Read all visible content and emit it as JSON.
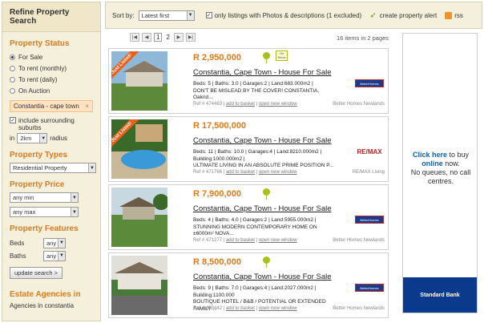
{
  "sidebar": {
    "heading": "Refine Property Search",
    "status_title": "Property Status",
    "status_options": [
      {
        "label": "For Sale",
        "selected": true
      },
      {
        "label": "To rent (monthly)",
        "selected": false
      },
      {
        "label": "To rent (daily)",
        "selected": false
      },
      {
        "label": "On Auction",
        "selected": false
      }
    ],
    "location_tag": "Constantia - cape town",
    "location_tag_remove": "×",
    "include_suburbs_label": "include surrounding suburbs",
    "radius_prefix": "in",
    "radius_value": "2km",
    "radius_suffix": "radius",
    "types_title": "Property Types",
    "type_value": "Residential Property",
    "price_title": "Property Price",
    "price_min": "any min",
    "price_max": "any max",
    "features_title": "Property Features",
    "beds_label": "Beds",
    "beds_value": "any",
    "baths_label": "Baths",
    "baths_value": "any",
    "update_button": "update search >",
    "agencies_title": "Estate Agencies in",
    "agencies_sub": "Agencies in constantia"
  },
  "topbar": {
    "sort_label": "Sort by:",
    "sort_value": "Latest first",
    "only_listings_label": "only listings with Photos & descriptions (1 excluded)",
    "alert_label": "create property alert",
    "rss_label": "rss"
  },
  "pager": {
    "pages": [
      "1",
      "2"
    ],
    "current": "1",
    "info": "16 items in 2 pages"
  },
  "listings": [
    {
      "price": "R 2,950,000",
      "title": "Constantia, Cape Town - House For Sale",
      "details": "Beds: 5 | Baths: 3.0 | Garages:2 | Land:683.000m2 |",
      "blurb": "DON'T BE MISLEAD BY THE COVER! CONSTANTIA, Oakrid...",
      "ref": "Ref # 474463",
      "basket": "add to basket",
      "newwin": "open new window",
      "agent": "Better Homes Newlands",
      "logo": "BetterHomes",
      "just_listed": "Just Listed!",
      "on_show": "On Show",
      "photo_sky": "#8fb8d8",
      "photo_ground": "#5d8a3a",
      "photo_house": "#d8d0c0"
    },
    {
      "price": "R 17,500,000",
      "title": "Constantia, Cape Town - House For Sale",
      "details": "Beds: 11 | Baths: 10.0 | Garages:4 | Land:8210.000m2 |",
      "details2": "Building:1000.000m2 |",
      "blurb": "ULTIMATE LIVING IN AN ABSOLUTE PRIME POSITION P...",
      "ref": "Ref # 471766",
      "basket": "add to basket",
      "newwin": "open new window",
      "agent": "RE/MAX Living",
      "logo": "RE/MAX",
      "just_listed": "Just Listed!",
      "photo_sky": "#3a6a2a",
      "photo_ground": "#3a9ad8",
      "photo_house": "#c8a878"
    },
    {
      "price": "R 7,900,000",
      "title": "Constantia, Cape Town - House For Sale",
      "details": "Beds: 4 | Baths: 4.0 | Garages:2 | Land:5955.000m2 |",
      "blurb": "STUNNING MODERN CONTEMPORARY HOME ON ±6000m² NOVA...",
      "ref": "Ref # 471277",
      "basket": "add to basket",
      "newwin": "open new window",
      "agent": "Better Homes Newlands",
      "logo": "BetterHomes",
      "photo_sky": "#c8d8e0",
      "photo_ground": "#5a8a3a",
      "photo_house": "#b8b098"
    },
    {
      "price": "R 8,500,000",
      "title": "Constantia, Cape Town - House For Sale",
      "details": "Beds: 9 | Baths: 7.0 | Garages:4 | Land:2027.000m2 | Building:1100.000",
      "blurb": "BOUTIQUE HOTEL / B&B / POTENTIAL OR EXTENDED FAMILY ...",
      "ref": "Ref # 469442",
      "basket": "add to basket",
      "newwin": "open new window",
      "agent": "Better Homes Newlands",
      "logo": "BetterHomes",
      "photo_sky": "#e0e0d8",
      "photo_ground": "#4a7a3a",
      "photo_house": "#e8e4dc"
    }
  ],
  "ad": {
    "click": "Click here",
    "line1": " to buy",
    "online": "online",
    "line2": " now.",
    "line3": "No queues, no call centres.",
    "bank": "Standard Bank"
  },
  "colors": {
    "accent": "#e07a1a",
    "panel": "#f5f0dc"
  }
}
